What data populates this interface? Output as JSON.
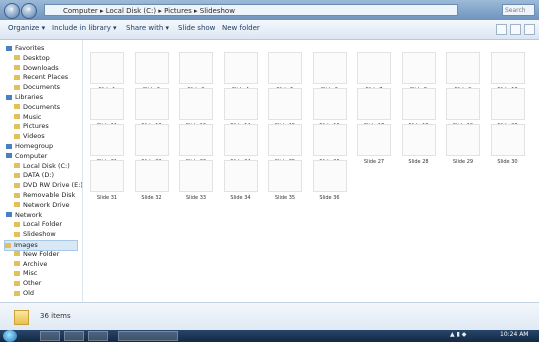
{
  "window": {
    "address_path": "Computer ▸ Local Disk (C:) ▸ Pictures ▸ Slideshow",
    "search_placeholder": "Search"
  },
  "toolbar": {
    "organize": "Organize ▾",
    "include": "Include in library ▾",
    "share": "Share with ▾",
    "slideshow": "Slide show",
    "new_folder": "New folder"
  },
  "sidebar": [
    {
      "label": "Favorites",
      "kind": "header"
    },
    {
      "label": "Desktop",
      "kind": "item"
    },
    {
      "label": "Downloads",
      "kind": "item"
    },
    {
      "label": "Recent Places",
      "kind": "item"
    },
    {
      "label": "Documents",
      "kind": "item"
    },
    {
      "label": "Libraries",
      "kind": "header"
    },
    {
      "label": "Documents",
      "kind": "item"
    },
    {
      "label": "Music",
      "kind": "item"
    },
    {
      "label": "Pictures",
      "kind": "item"
    },
    {
      "label": "Videos",
      "kind": "item"
    },
    {
      "label": "Homegroup",
      "kind": "header"
    },
    {
      "label": "Computer",
      "kind": "header"
    },
    {
      "label": "Local Disk (C:)",
      "kind": "item"
    },
    {
      "label": "DATA (D:)",
      "kind": "item"
    },
    {
      "label": "DVD RW Drive (E:)",
      "kind": "item"
    },
    {
      "label": "Removable Disk",
      "kind": "item"
    },
    {
      "label": "Network Drive",
      "kind": "item"
    },
    {
      "label": "Network",
      "kind": "header"
    },
    {
      "label": "Local Folder",
      "kind": "item"
    },
    {
      "label": "Slideshow",
      "kind": "item"
    },
    {
      "label": "Images",
      "kind": "item",
      "selected": true
    },
    {
      "label": "New Folder",
      "kind": "item"
    },
    {
      "label": "Archive",
      "kind": "item"
    },
    {
      "label": "Misc",
      "kind": "item"
    },
    {
      "label": "Other",
      "kind": "item"
    },
    {
      "label": "Old",
      "kind": "item"
    }
  ],
  "files": [
    "Slide 1",
    "Slide 2",
    "Slide 3",
    "Slide 4",
    "Slide 5",
    "Slide 6",
    "Slide 7",
    "Slide 8",
    "Slide 9",
    "Slide 10",
    "Slide 11",
    "Slide 12",
    "Slide 13",
    "Slide 14",
    "Slide 15",
    "Slide 16",
    "Slide 17",
    "Slide 18",
    "Slide 19",
    "Slide 20",
    "Slide 21",
    "Slide 22",
    "Slide 23",
    "Slide 24",
    "Slide 25",
    "Slide 26",
    "Slide 27",
    "Slide 28",
    "Slide 29",
    "Slide 30",
    "Slide 31",
    "Slide 32",
    "Slide 33",
    "Slide 34",
    "Slide 35",
    "Slide 36"
  ],
  "details": {
    "item_count": "36 items"
  },
  "taskbar": {
    "clock": "10:24 AM"
  },
  "colors": {
    "titlebar": "#6f93bd",
    "selection": "#d9e8f7",
    "taskbar": "#142842",
    "folder": "#e8c04e"
  }
}
